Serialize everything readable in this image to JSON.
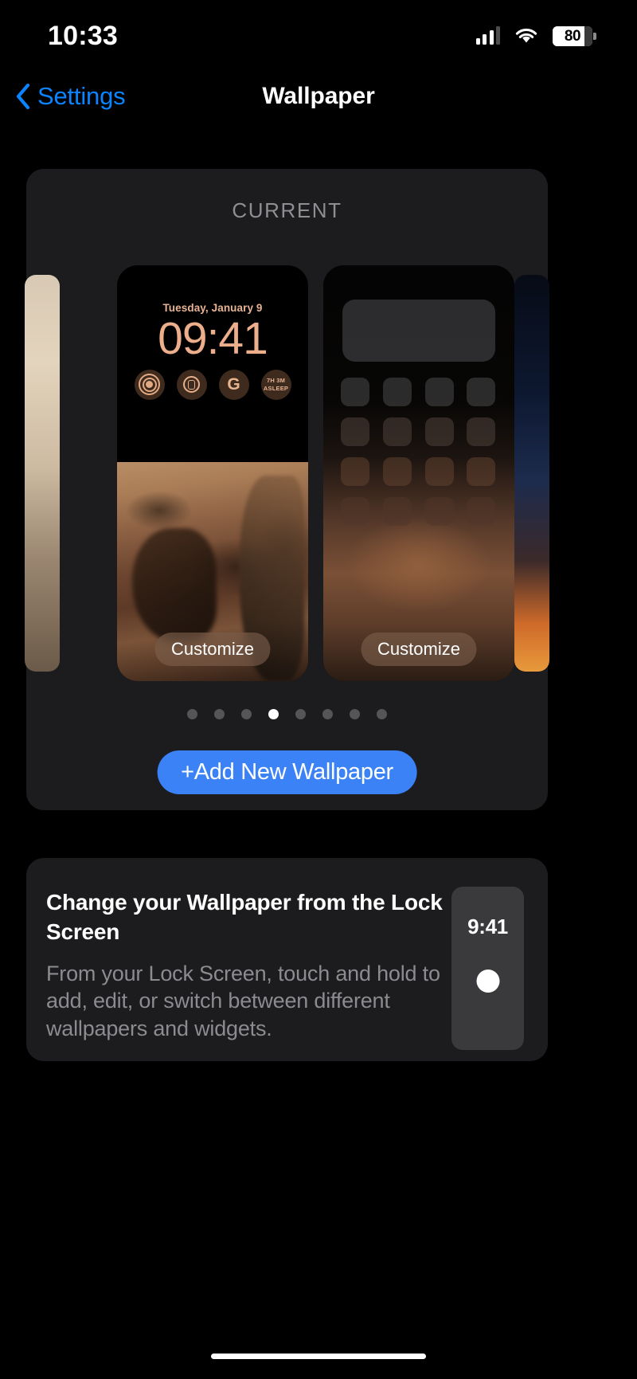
{
  "status_bar": {
    "time": "10:33",
    "battery_level": "80",
    "icons": [
      "cellular-signal-icon",
      "wifi-icon",
      "battery-icon"
    ]
  },
  "nav": {
    "back_label": "Settings",
    "title": "Wallpaper",
    "back_icon": "chevron-left-icon",
    "accent_color": "#0a84ff"
  },
  "current": {
    "section_label": "CURRENT",
    "lock_preview": {
      "date": "Tuesday, January 9",
      "time": "09:41",
      "customize_label": "Customize",
      "widgets": [
        {
          "name": "fitness-rings-widget",
          "text": ""
        },
        {
          "name": "watch-battery-widget",
          "text": ""
        },
        {
          "name": "google-widget",
          "text": "G"
        },
        {
          "name": "sleep-widget",
          "text": "7H 3M ASLEEP"
        }
      ]
    },
    "home_preview": {
      "customize_label": "Customize"
    },
    "page_dots": {
      "count": 8,
      "active_index": 3
    },
    "add_button": {
      "plus": "+",
      "label": "Add New Wallpaper",
      "color": "#3b82f6"
    }
  },
  "info": {
    "title": "Change your Wallpaper from the Lock Screen",
    "body": "From your Lock Screen, touch and hold to add, edit, or switch between different wallpapers and widgets.",
    "mini_time": "9:41"
  }
}
